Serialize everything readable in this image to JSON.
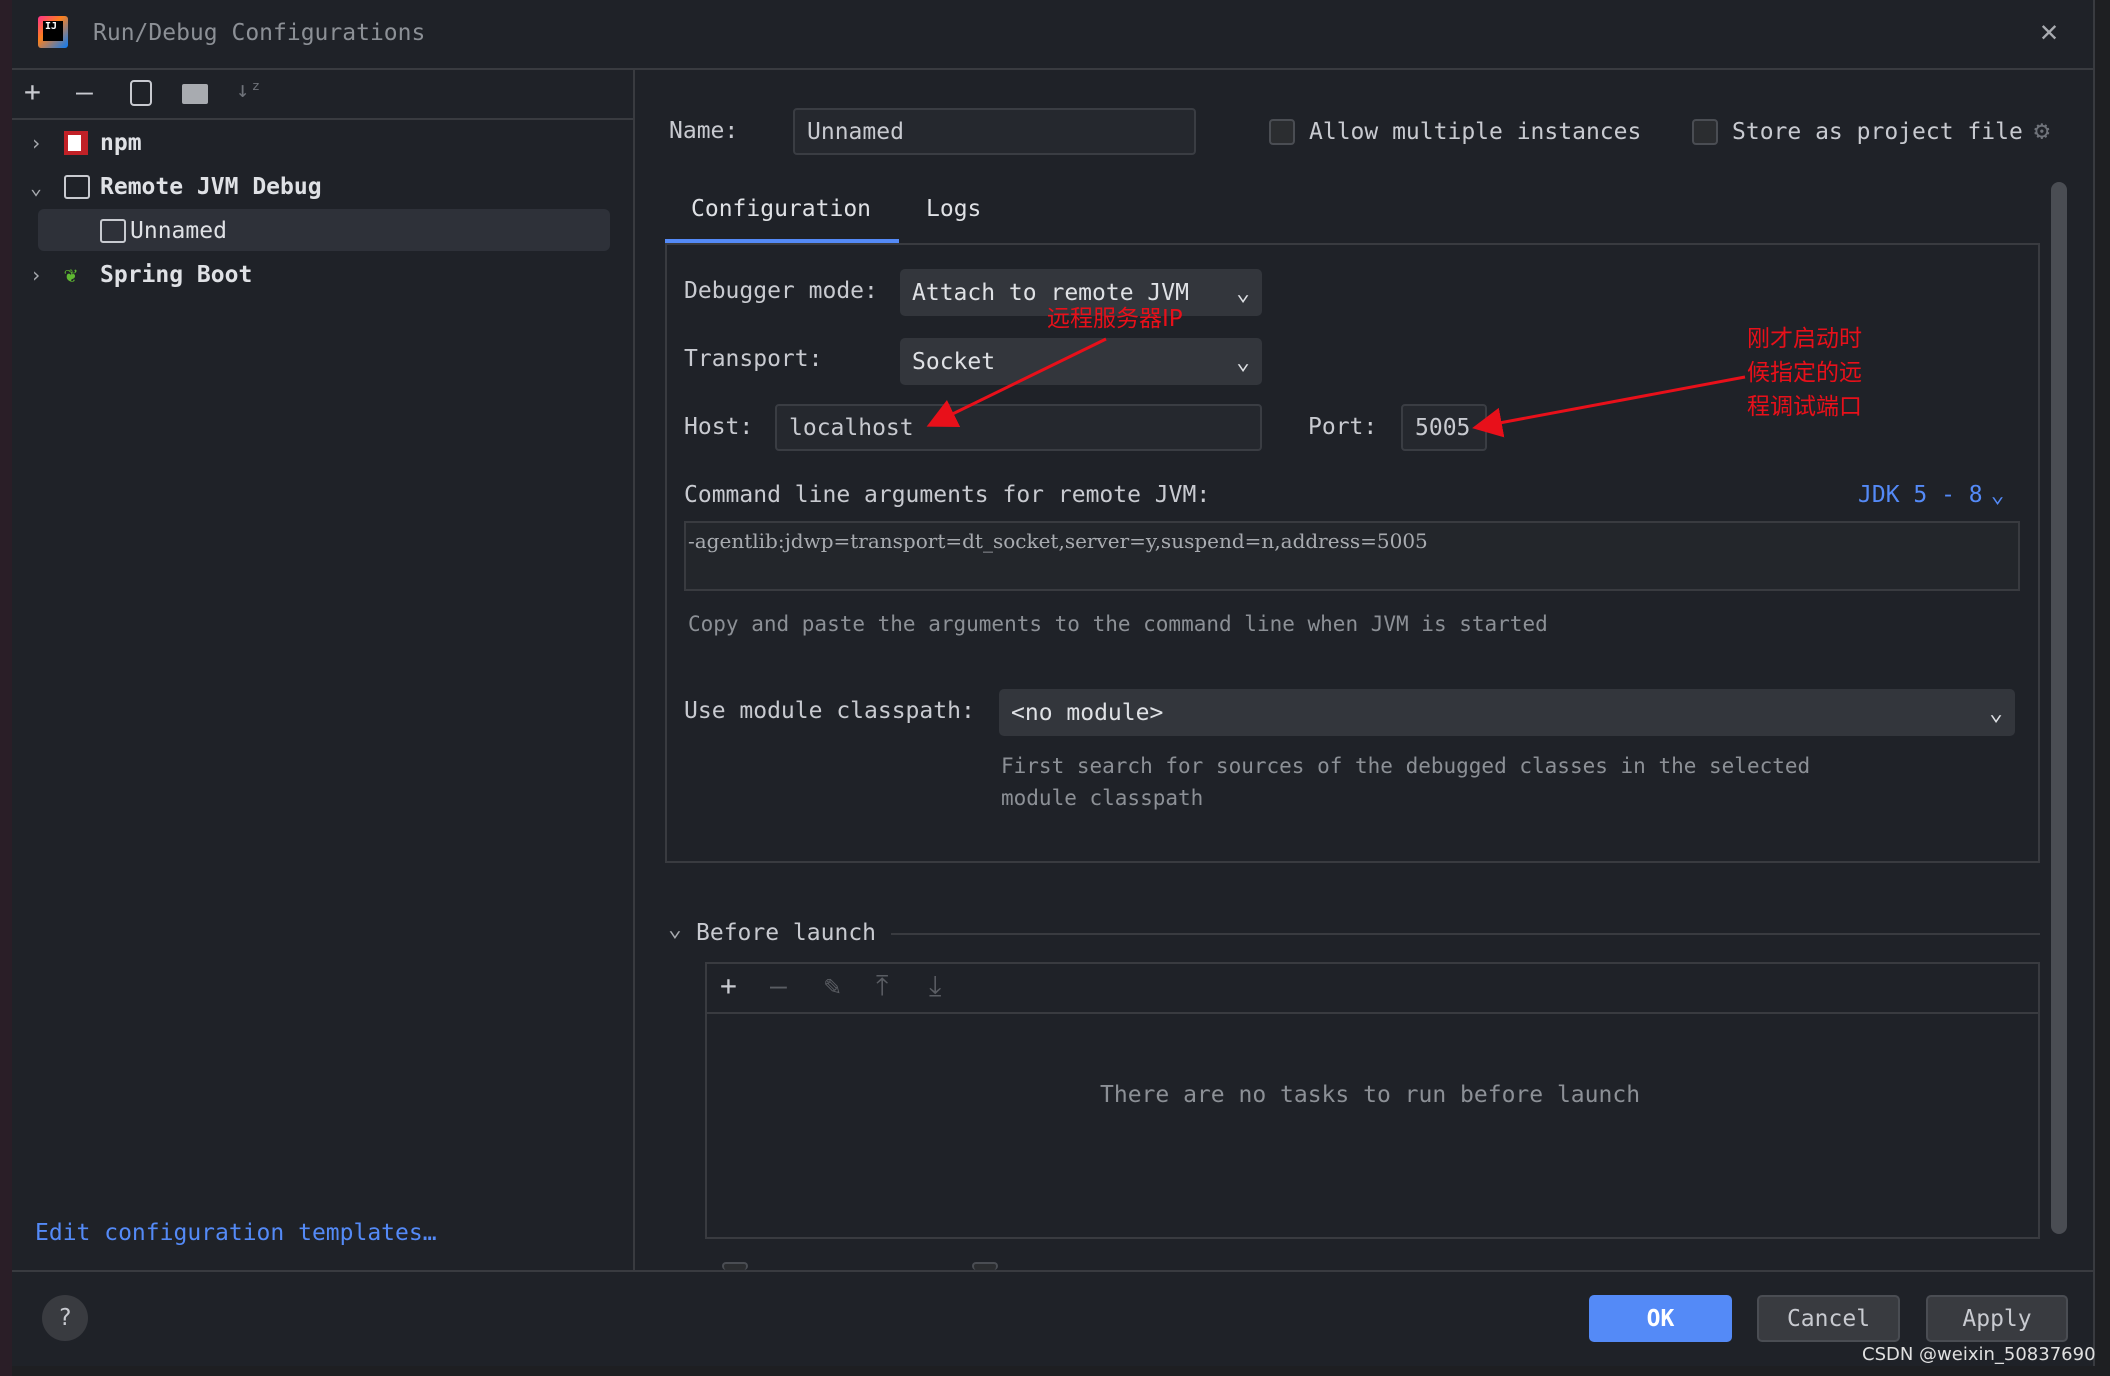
{
  "window": {
    "title": "Run/Debug Configurations"
  },
  "toolbar": {
    "icons": [
      "plus-icon",
      "minus-icon",
      "copy-icon",
      "new-folder-icon",
      "sort-icon"
    ]
  },
  "tree": {
    "items": [
      {
        "label": "npm",
        "expanded": false
      },
      {
        "label": "Remote JVM Debug",
        "expanded": true
      },
      {
        "label": "Unnamed",
        "selected": true
      },
      {
        "label": "Spring Boot",
        "expanded": false
      }
    ]
  },
  "edit_templates_link": "Edit configuration templates…",
  "form": {
    "name_label": "Name:",
    "name_value": "Unnamed",
    "allow_multiple": "Allow multiple instances",
    "allow_multiple_checked": false,
    "store_project": "Store as project file",
    "store_project_checked": false,
    "tabs": [
      "Configuration",
      "Logs"
    ],
    "active_tab": "Configuration",
    "debugger_mode_label": "Debugger mode:",
    "debugger_mode_value": "Attach to remote JVM",
    "transport_label": "Transport:",
    "transport_value": "Socket",
    "host_label": "Host:",
    "host_value": "localhost",
    "port_label": "Port:",
    "port_value": "5005",
    "cmd_label": "Command line arguments for remote JVM:",
    "jdk_select": "JDK 5 - 8",
    "cmd_value": "-agentlib:jdwp=transport=dt_socket,server=y,suspend=n,address=5005",
    "cmd_hint": "Copy and paste the arguments to the command line when JVM is started",
    "module_label": "Use module classpath:",
    "module_value": "<no module>",
    "module_hint_1": "First search for sources of the debugged classes in the selected",
    "module_hint_2": "module classpath",
    "before_launch": "Before launch",
    "no_tasks": "There are no tasks to run before launch"
  },
  "annotations": {
    "host_note": "远程服务器IP",
    "port_note": [
      "刚才启动时",
      "候指定的远",
      "程调试端口"
    ],
    "color": "#e8101a"
  },
  "buttons": {
    "ok": "OK",
    "cancel": "Cancel",
    "apply": "Apply",
    "help": "?"
  },
  "watermark": "CSDN @weixin_50837690",
  "colors": {
    "accent": "#548af7",
    "link": "#548af7"
  }
}
